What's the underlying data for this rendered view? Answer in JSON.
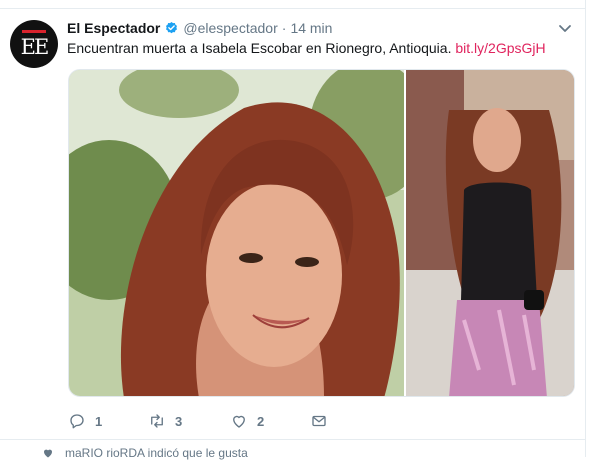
{
  "tweet": {
    "avatar_text": "EE",
    "author_name": "El Espectador",
    "handle": "@elespectador",
    "separator": "·",
    "time": "14 min",
    "text": "Encuentran muerta a Isabela Escobar en Rionegro, Antioquia.",
    "link": "bit.ly/2GpsGjH"
  },
  "actions": {
    "reply_count": "1",
    "retweet_count": "3",
    "like_count": "2"
  },
  "activity": {
    "text": "maRIO rioRDA indicó que le gusta"
  },
  "colors": {
    "link": "#e0245e",
    "verified": "#1da1f2",
    "muted": "#657786"
  },
  "icons": [
    "verified-badge-icon",
    "chevron-down-icon",
    "reply-icon",
    "retweet-icon",
    "like-icon",
    "direct-message-icon",
    "heart-icon"
  ]
}
